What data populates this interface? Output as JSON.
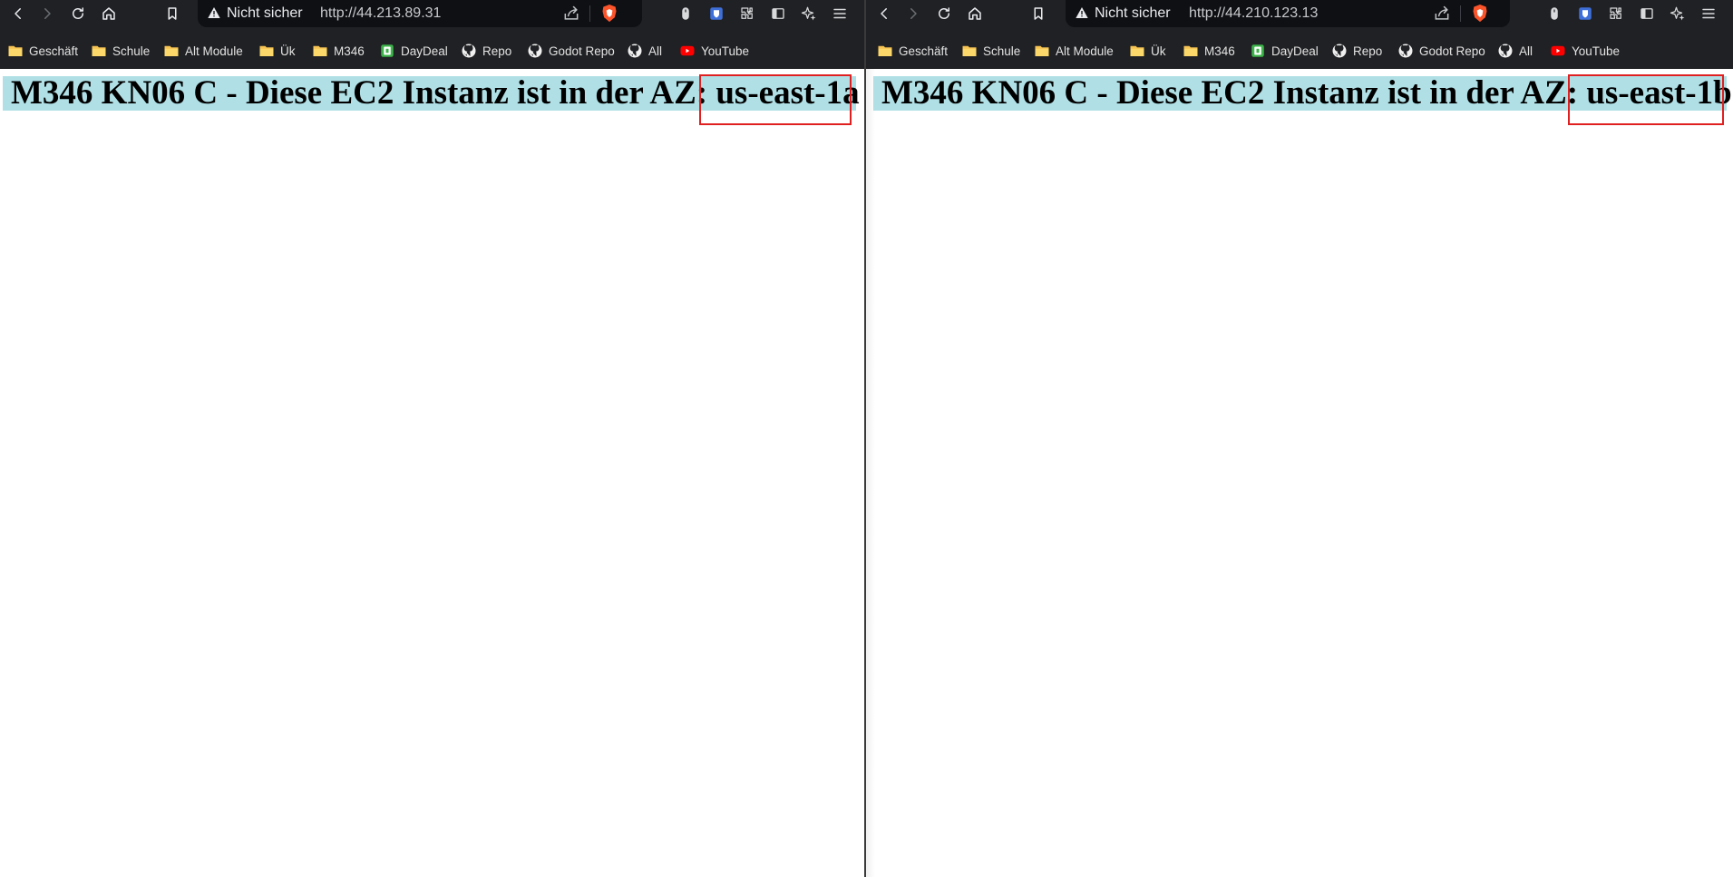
{
  "bookmarks": [
    {
      "label": "Geschäft",
      "icon": "folder-icon"
    },
    {
      "label": "Schule",
      "icon": "folder-icon"
    },
    {
      "label": "Alt Module",
      "icon": "folder-icon"
    },
    {
      "label": "Ük",
      "icon": "folder-icon"
    },
    {
      "label": "M346",
      "icon": "folder-icon"
    },
    {
      "label": "DayDeal",
      "icon": "daydeal-icon"
    },
    {
      "label": "Repo",
      "icon": "github-icon"
    },
    {
      "label": "Godot Repo",
      "icon": "github-icon"
    },
    {
      "label": "All",
      "icon": "github-icon"
    },
    {
      "label": "YouTube",
      "icon": "youtube-icon"
    }
  ],
  "windows": [
    {
      "security_label": "Nicht sicher",
      "url": "http://44.213.89.31",
      "heading_prefix": "M346 KN06 C - Diese EC2 Instanz ist in der AZ:",
      "az": "us-east-1a"
    },
    {
      "security_label": "Nicht sicher",
      "url": "http://44.210.123.13",
      "heading_prefix": "M346 KN06 C - Diese EC2 Instanz ist in der AZ:",
      "az": "us-east-1b"
    }
  ],
  "colors": {
    "heading_background": "#b0e0e6",
    "highlight_border": "#e02020",
    "browser_chrome": "#202124"
  }
}
